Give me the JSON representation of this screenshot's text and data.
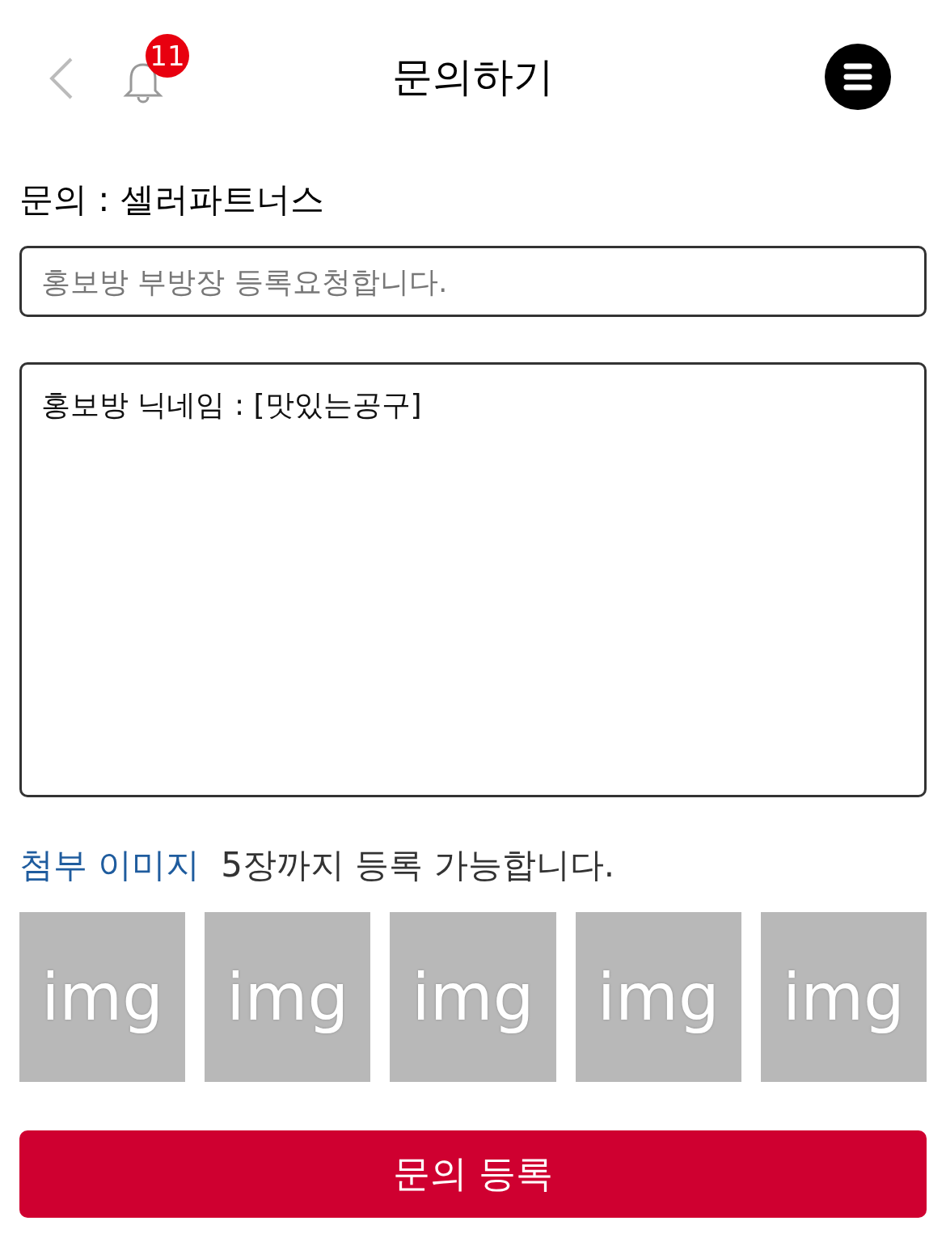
{
  "header": {
    "title": "문의하기",
    "notification_count": "11"
  },
  "inquiry_label": "문의 : 셀러파트너스",
  "subject_field": {
    "placeholder": "홍보방 부방장 등록요청합니다."
  },
  "body_field": {
    "value": "홍보방 닉네임 : [맛있는공구]"
  },
  "attachments": {
    "title": "첨부 이미지",
    "hint": "5장까지 등록 가능합니다.",
    "slots": [
      {
        "label": "img"
      },
      {
        "label": "img"
      },
      {
        "label": "img"
      },
      {
        "label": "img"
      },
      {
        "label": "img"
      }
    ]
  },
  "submit_button": "문의 등록"
}
